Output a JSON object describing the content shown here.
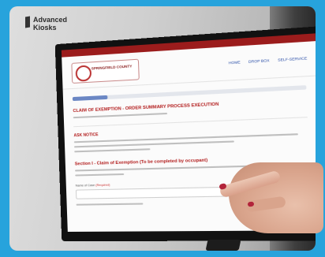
{
  "kiosk": {
    "brand_line1": "Advanced",
    "brand_line2": "Kiosks"
  },
  "app": {
    "county_name": "SPRINGFIELD COUNTY",
    "nav": [
      "HOME",
      "DROP BOX",
      "SELF-SERVICE"
    ],
    "progress": 0.16,
    "form_title": "CLAIM OF EXEMPTION - ORDER SUMMARY PROCESS EXECUTION",
    "notice_title": "ASK NOTICE",
    "section_title": "Section I - Claim of Exemption (To be completed by occupant)",
    "field_label": "Name of Case",
    "field_required": "(Required)"
  },
  "colors": {
    "accent": "#27a3dc",
    "brand_red": "#b21c1c",
    "nav_blue": "#2b4fa8",
    "nail": "#b2243a"
  }
}
